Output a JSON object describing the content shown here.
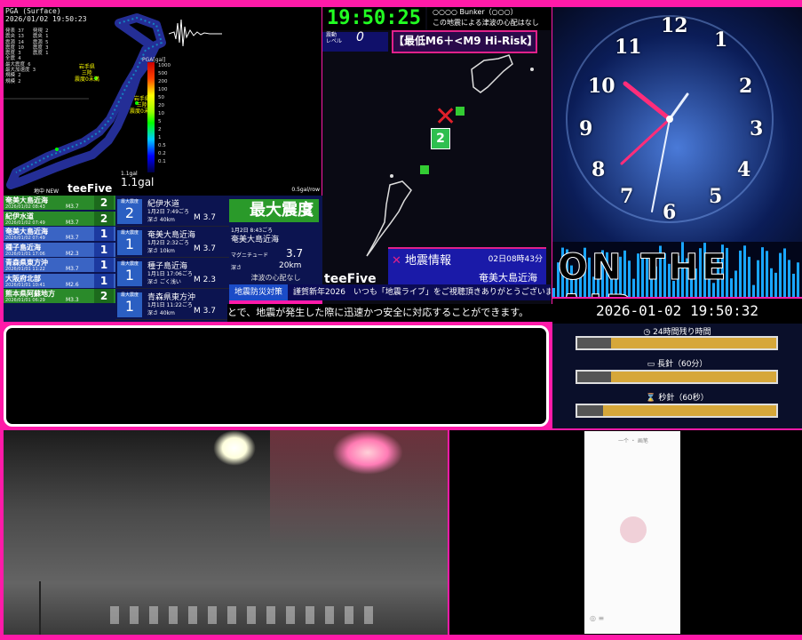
{
  "seismic": {
    "header_line1": "PGA (Surface)",
    "header_line2": "2026/01/02 19:50:23",
    "legend_text": "発表 37   発現 2\n震央 13   震央 1\n震源 14   震源 5\n震度 10   震度 3\n震度 3    震度 1\n全震 4\n最大震度 6\n最大加速度 3\n規模 2\n規模 2",
    "pga_unit": "PGA[gal]",
    "scale_values": [
      "1000",
      "500",
      "200",
      "100",
      "50",
      "20",
      "10",
      "5",
      "2",
      "1",
      "0.5",
      "0.2",
      "0.1"
    ],
    "region_label_1": "岩手県\n三陸\n震度0未満",
    "region_label_2": "岩手県\n三陸\n震度0未満",
    "small_gal": "1.1gal",
    "gal_value": "1.1gal",
    "brand": "teeFive",
    "brand_small": "地中 NEW",
    "corner": "0.5gal/row"
  },
  "time_panel": {
    "clock": "19:50:25",
    "tsunami_line1": "○○○○ Bunker（○○○）",
    "tsunami_line2": "この地震による津波の心配はなし",
    "level_label": "震動\nレベル",
    "level_value": "0",
    "risk_banner": "【最低M6＋<M9 Hi-Risk】",
    "map_intensity": "2",
    "brand": "teeFive",
    "eq_title": "地震情報",
    "eq_time": "02日08時43分",
    "eq_region": "奄美大島近海"
  },
  "quake_list": [
    {
      "name": "奄美大島近海",
      "date": "2026/01/02 08:43",
      "mag": "M3.7",
      "intensity": "2",
      "color": "green"
    },
    {
      "name": "紀伊水道",
      "date": "2026/01/02 07:49",
      "mag": "M3.7",
      "intensity": "2",
      "color": "green"
    },
    {
      "name": "奄美大島近海",
      "date": "2026/01/02 07:49",
      "mag": "M3.7",
      "intensity": "1",
      "color": "blue"
    },
    {
      "name": "種子島近海",
      "date": "2026/01/01 17:06",
      "mag": "M2.3",
      "intensity": "1",
      "color": "blue"
    },
    {
      "name": "青森県東方沖",
      "date": "2026/01/01 11:22",
      "mag": "M3.7",
      "intensity": "1",
      "color": "blue"
    },
    {
      "name": "大阪府北部",
      "date": "2026/01/01 10:41",
      "mag": "M2.6",
      "intensity": "1",
      "color": "blue"
    },
    {
      "name": "熊本県阿蘇地方",
      "date": "2026/01/01 06:29",
      "mag": "M3.3",
      "intensity": "2",
      "color": "green"
    }
  ],
  "quake_cards": [
    {
      "name": "紀伊水道",
      "date": "1月2日 7:49ごろ",
      "depth": "深さ 40km",
      "mag": "M 3.7",
      "intensity": "2",
      "label": "最大震度"
    },
    {
      "name": "奄美大島近海",
      "date": "1月2日 2:32ごろ",
      "depth": "深さ 10km",
      "mag": "M 3.7",
      "intensity": "1",
      "label": "最大震度"
    },
    {
      "name": "種子島近海",
      "date": "1月1日 17:06ごろ",
      "depth": "深さ ごく浅い",
      "mag": "M 2.3",
      "intensity": "1",
      "label": "最大震度"
    },
    {
      "name": "青森県東方沖",
      "date": "1月1日 11:22ごろ",
      "depth": "深さ 40km",
      "mag": "M 3.7",
      "intensity": "1",
      "label": "最大震度"
    }
  ],
  "max_box": {
    "label": "最大震度",
    "value": "2",
    "date": "1月2日 8:43ごろ",
    "region_line1": "奄美大島近海",
    "magnitude_label": "マグニチュード",
    "magnitude": "3.7",
    "depth_label": "深さ",
    "depth": "20km",
    "tsunami": "津波の心配なし"
  },
  "ticker": {
    "tag": "地震防災対策",
    "text": "謹賀新年2026　いつも「地震ライブ」をご視聴頂きありがとうございます!"
  },
  "scroll_text": "とで、地震が発生した際に迅速かつ安全に対応することができます。",
  "analog_clock": {
    "numbers": [
      "12",
      "1",
      "2",
      "3",
      "4",
      "5",
      "6",
      "7",
      "8",
      "9",
      "10",
      "11"
    ]
  },
  "on_air": "ON THE AIR",
  "datetime": "2026-01-02 19:50:32",
  "progress": {
    "day_label": "24時間残り時間",
    "day_fill": 0.17,
    "minute_label": "長針（60分）",
    "minute_fill": 0.17,
    "second_label": "秒針（60秒）",
    "second_fill": 0.13
  },
  "phone": {
    "title": "一个 ・ 画笔"
  }
}
